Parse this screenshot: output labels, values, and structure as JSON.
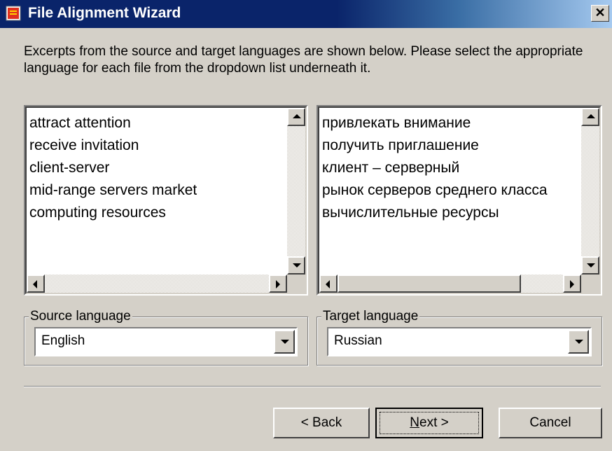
{
  "window": {
    "title": "File Alignment Wizard"
  },
  "description": "Excerpts from the source and target languages are shown below. Please select the appropriate language for each file from the dropdown list underneath it.",
  "source_list": {
    "items": [
      "attract attention",
      "receive invitation",
      "client-server",
      "mid-range servers market",
      "computing resources"
    ]
  },
  "target_list": {
    "items": [
      "привлекать внимание",
      "получить приглашение",
      "клиент – серверный",
      "рынок серверов среднего класса",
      "вычислительные ресурсы"
    ]
  },
  "source_language": {
    "label": "Source language",
    "selected": "English"
  },
  "target_language": {
    "label": "Target language",
    "selected": "Russian"
  },
  "buttons": {
    "back": "< Back",
    "next_mnemonic": "N",
    "next_rest": "ext >",
    "cancel": "Cancel"
  },
  "icons": {
    "app": "wizard-icon",
    "close": "close-icon"
  }
}
